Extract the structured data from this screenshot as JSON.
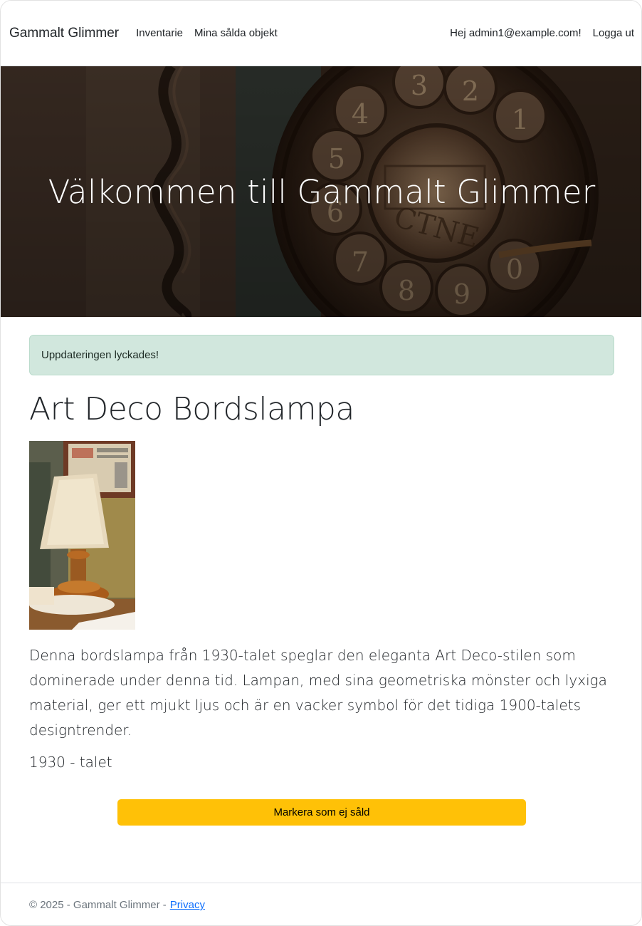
{
  "navbar": {
    "brand": "Gammalt Glimmer",
    "links": [
      "Inventarie",
      "Mina sålda objekt"
    ],
    "greeting": "Hej admin1@example.com!",
    "logout": "Logga ut"
  },
  "hero": {
    "title": "Välkommen till Gammalt Glimmer",
    "dial_digits": [
      "1",
      "2",
      "3",
      "4",
      "5",
      "6",
      "7",
      "8",
      "9",
      "0"
    ],
    "dial_text": "CTNE"
  },
  "alert": {
    "message": "Uppdateringen lyckades!"
  },
  "item": {
    "title": "Art Deco Bordslampa",
    "description": "Denna bordslampa från 1930-talet speglar den eleganta Art Deco-stilen som dominerade under denna tid. Lampan, med sina geometriska mönster och lyxiga material, ger ett mjukt ljus och är en vacker symbol för det tidiga 1900-talets designtrender.",
    "era": "1930 - talet",
    "button_label": "Markera som ej såld"
  },
  "footer": {
    "copyright": "© 2025 - Gammalt Glimmer -",
    "privacy": "Privacy"
  },
  "colors": {
    "alert_bg": "#d1e7dd",
    "button_bg": "#ffc107",
    "link": "#0d6efd"
  }
}
